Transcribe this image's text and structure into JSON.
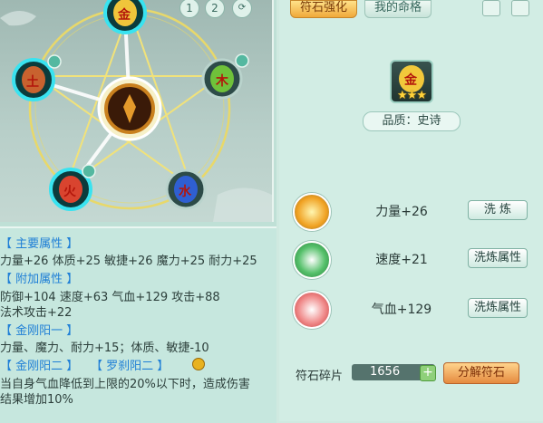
{
  "wheel": {
    "page_tabs": [
      "1",
      "2"
    ],
    "elements": {
      "top": "金",
      "left": "土",
      "right": "木",
      "bottom_left": "火",
      "bottom_right": "水"
    }
  },
  "info": {
    "main_header": "【 主要属性 】",
    "main_attrs": "力量+26 体质+25 敏捷+26 魔力+25 耐力+25",
    "extra_header": "【 附加属性 】",
    "extra_line1": "防御+104 速度+63 气血+129 攻击+88",
    "extra_line2": "法术攻击+22",
    "set1_header": "【 金刚阳一 】",
    "set1_desc": "力量、魔力、耐力+15；体质、敏捷-10",
    "set2_header_a": "【 金刚阳二 】",
    "set2_header_b": "【 罗刹阳二 】",
    "set2_desc_line1": "当自身气血降低到上限的20%以下时，造成伤害",
    "set2_desc_line2": "结果增加10%"
  },
  "right": {
    "tab_active": "符石强化",
    "tab_idle": "我的命格",
    "gem_symbol": "金",
    "stars": "★★★",
    "quality": "品质：史诗",
    "rows": [
      {
        "text": "力量+26",
        "button": "洗 炼"
      },
      {
        "text": "速度+21",
        "button": "洗炼属性"
      },
      {
        "text": "气血+129",
        "button": "洗炼属性"
      }
    ],
    "fragments_label": "符石碎片",
    "fragments_value": "1656",
    "plus": "+",
    "decompose_button": "分解符石"
  }
}
